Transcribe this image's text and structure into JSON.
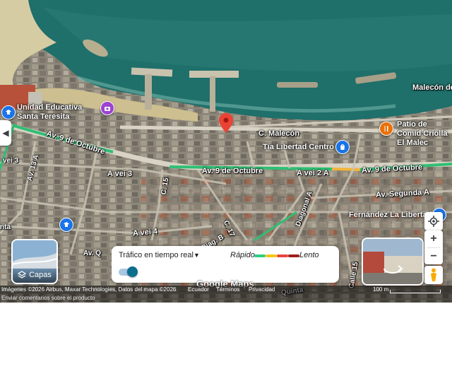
{
  "colors": {
    "sea": "#1f6f6a",
    "sea_light": "#4d9c94",
    "sand": "#d8cfa8",
    "land": "#8a8578",
    "road_green": "#2fbf74",
    "road_yellow": "#f2b53a",
    "pin_red": "#ea4335",
    "poi_blue": "#1a73e8",
    "poi_orange": "#e8710a",
    "poi_purple": "#9c43d0"
  },
  "streets": {
    "av9_left": "Av. 9 de Octubre",
    "av9_center": "Av. 9 de Octubre",
    "av9_right": "Av. 9 de Octubre",
    "malecon": "C. Malecón",
    "malecon_de": "Malecón de",
    "avei3": "A vei 3",
    "avei2": "A vei 2 A",
    "avei4": "A vei 4",
    "c15": "C. 15",
    "c17": "C. 17",
    "diagonal": "Diagonal A",
    "diag_b": "Diag. B",
    "av13": "Av. 13 A",
    "vei3_left": "vei 3",
    "segunda": "Av. Segunda A",
    "quinta": "Quinta",
    "av_q": "Av. Q",
    "calle15": "Calle 15",
    "nta": "nta"
  },
  "pois": {
    "school": "Unidad Educativa Santa Teresita",
    "tia": "Tía Libertad Centro",
    "patio": "Patio de Comid Criolla El Malec",
    "fernandez": "Fernández La Libertad"
  },
  "controls": {
    "collapse_icon": "chevron-left-icon",
    "layers_label": "Capas",
    "traffic_title": "Tráfico en tiempo real",
    "traffic_fast": "Rápido",
    "traffic_slow": "Lento",
    "traffic_colors": [
      "#2fcf7e",
      "#f5c518",
      "#e8453c",
      "#a11d1d"
    ],
    "zoom_in": "+",
    "zoom_out": "−",
    "google": "Google Maps"
  },
  "attribution": {
    "imagery": "Imágenes ©2026 Airbus, Maxar Technologies, Datos del mapa ©2026",
    "country": "Ecuador",
    "terms": "Términos",
    "privacy": "Privacidad",
    "scale": "100 m",
    "feedback": "Enviar comentarios sobre el producto"
  }
}
